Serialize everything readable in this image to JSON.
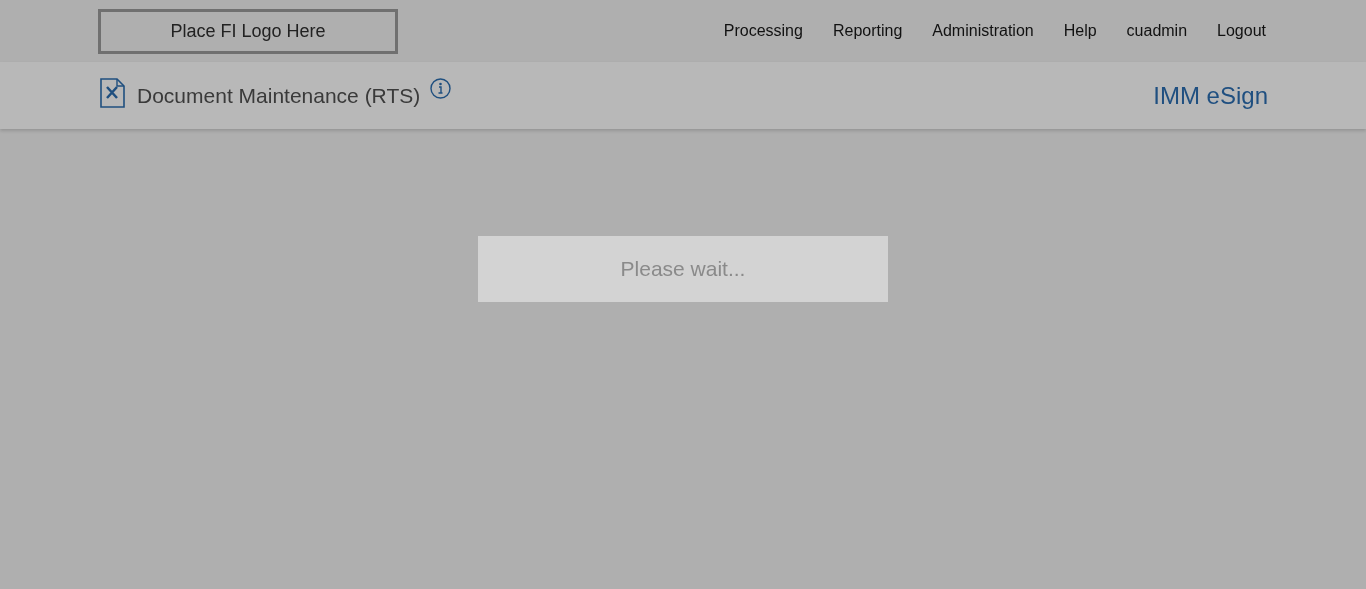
{
  "logo": {
    "text": "Place FI Logo Here"
  },
  "nav": {
    "items": [
      "Processing",
      "Reporting",
      "Administration",
      "Help",
      "cuadmin",
      "Logout"
    ]
  },
  "page_header": {
    "title": "Document Maintenance (RTS)",
    "product": "IMM eSign"
  },
  "loading": {
    "message": "Please wait..."
  }
}
